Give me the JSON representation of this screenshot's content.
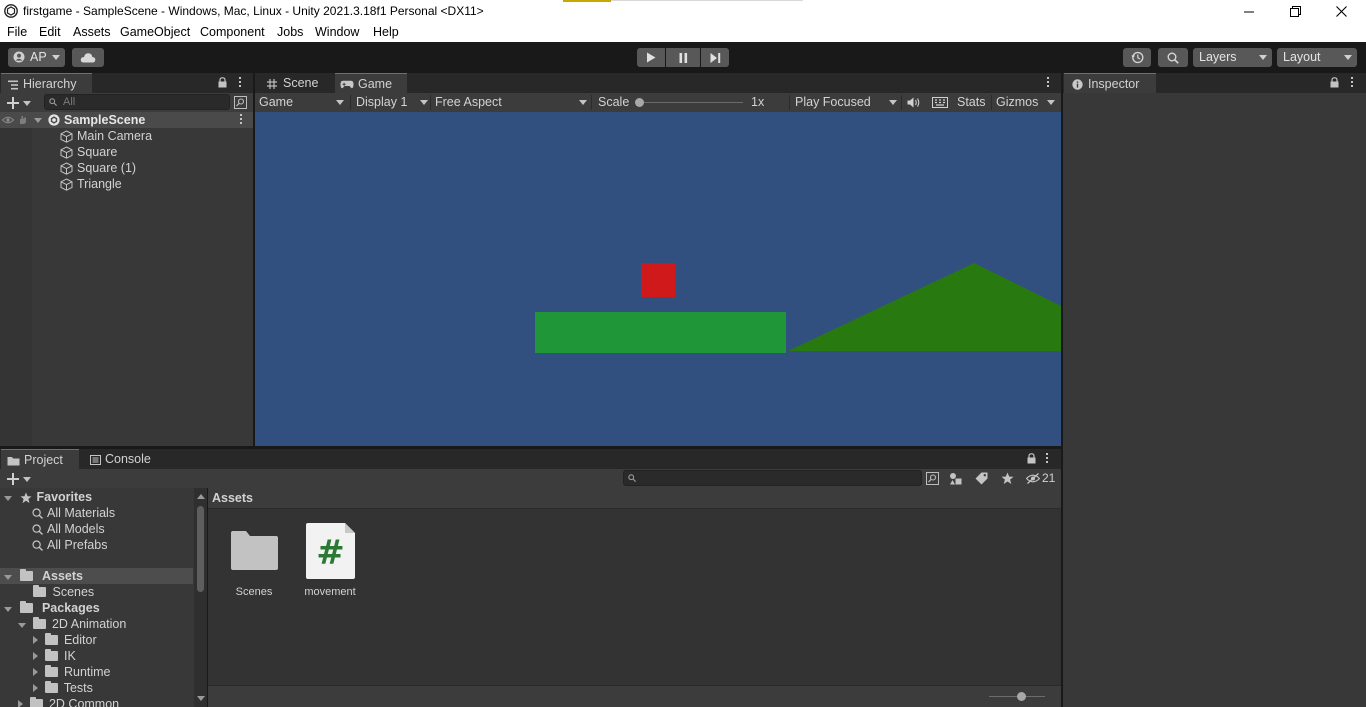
{
  "window": {
    "title": "firstgame - SampleScene - Windows, Mac, Linux - Unity 2021.3.18f1 Personal <DX11>",
    "icon": "unity-logo-icon",
    "controls": [
      "minimize-icon",
      "restore-icon",
      "close-icon"
    ]
  },
  "menu": [
    "File",
    "Edit",
    "Assets",
    "GameObject",
    "Component",
    "Jobs",
    "Window",
    "Help"
  ],
  "toolbar": {
    "account_label": "AP",
    "layers_label": "Layers",
    "layout_label": "Layout"
  },
  "hierarchy": {
    "tab_label": "Hierarchy",
    "search_placeholder": "All",
    "scene_name": "SampleScene",
    "objects": [
      "Main Camera",
      "Square",
      "Square (1)",
      "Triangle"
    ]
  },
  "view_tabs": {
    "scene_label": "Scene",
    "game_label": "Game"
  },
  "game_toolbar": {
    "view_mode": "Game",
    "display": "Display 1",
    "aspect": "Free Aspect",
    "scale_label": "Scale",
    "scale_value": "1x",
    "scale_level": 0,
    "play_mode": "Play Focused",
    "stats_label": "Stats",
    "gizmos_label": "Gizmos"
  },
  "game_view": {
    "background_color": "#32507f",
    "player_color": "#d0191b",
    "platform_color": "#1f9637",
    "hill_color": "#287a10"
  },
  "inspector": {
    "tab_label": "Inspector"
  },
  "project": {
    "tab_label": "Project",
    "console_label": "Console",
    "hidden_count": "21",
    "favorites_label": "Favorites",
    "favorites": [
      "All Materials",
      "All Models",
      "All Prefabs"
    ],
    "assets_label": "Assets",
    "assets_children": [
      "Scenes"
    ],
    "packages_label": "Packages",
    "animation_package": "2D Animation",
    "animation_children": [
      "Editor",
      "IK",
      "Runtime",
      "Tests"
    ],
    "next_package": "2D Common",
    "breadcrumb": "Assets",
    "grid_items": [
      {
        "name": "Scenes",
        "icon": "folder-icon"
      },
      {
        "name": "movement",
        "icon": "csharp-script-icon"
      }
    ]
  }
}
